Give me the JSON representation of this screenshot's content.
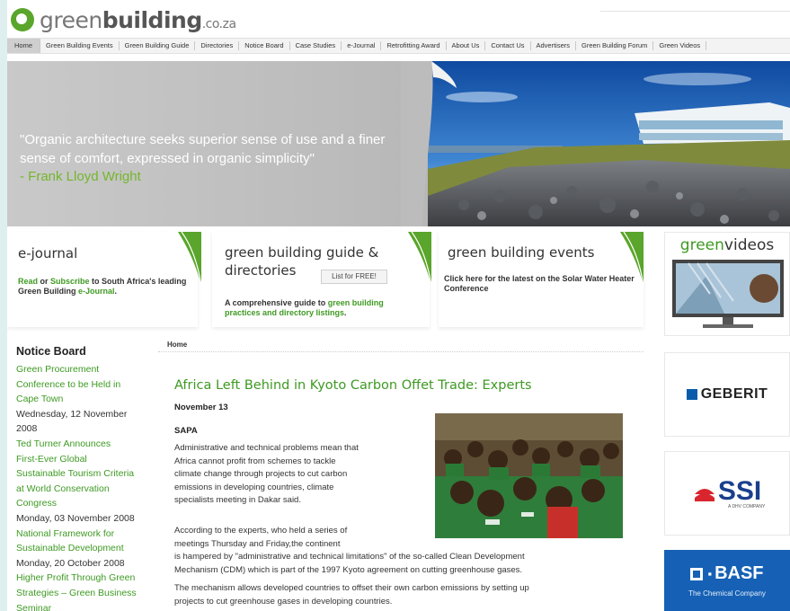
{
  "logo": {
    "part1": "green",
    "part2": "building",
    "suffix": ".co.za"
  },
  "nav": [
    "Home",
    "Green Building Events",
    "Green Building Guide",
    "Directories",
    "Notice Board",
    "Case Studies",
    "e-Journal",
    "Retrofitting Award",
    "About Us",
    "Contact Us",
    "Advertisers",
    "Green Building Forum",
    "Green Videos"
  ],
  "hero": {
    "quote": "\"Organic architecture seeks superior sense of use and a finer sense of comfort, expressed in organic simplicity\"",
    "author": "- Frank Lloyd Wright"
  },
  "boxes": {
    "ejournal": {
      "title": "e-journal",
      "link1": "Read",
      "or": " or ",
      "link2": "Subscribe",
      "text": " to South Africa's leading Green Building ",
      "link3": "e-Journal",
      "end": "."
    },
    "guide": {
      "title_line1": "green building guide &",
      "title_line2": "directories",
      "button": "List for FREE!",
      "text": "A comprehensive guide to ",
      "link": "green building practices and directory listings",
      "end": "."
    },
    "events": {
      "title": "green building events",
      "text": "Click here for the latest on the Solar Water Heater Conference"
    }
  },
  "sidebar_ads": {
    "videos": {
      "title_green": "green",
      "title_rest": "videos"
    },
    "geberit": "GEBERIT",
    "ssi": {
      "name": "SSI",
      "sub": "A DHV COMPANY"
    },
    "basf": {
      "name": "BASF",
      "sub": "The Chemical Company"
    }
  },
  "notice_board": {
    "title": "Notice Board",
    "items": [
      {
        "type": "link",
        "text": "Green Procurement"
      },
      {
        "type": "link",
        "text": "Conference to be Held in"
      },
      {
        "type": "link",
        "text": "Cape Town"
      },
      {
        "type": "date",
        "text": "Wednesday, 12 November"
      },
      {
        "type": "date",
        "text": "2008"
      },
      {
        "type": "link",
        "text": "Ted Turner Announces"
      },
      {
        "type": "link",
        "text": "First-Ever Global"
      },
      {
        "type": "link",
        "text": "Sustainable Tourism Criteria"
      },
      {
        "type": "link",
        "text": "at World Conservation"
      },
      {
        "type": "link",
        "text": "Congress"
      },
      {
        "type": "date",
        "text": "Monday, 03 November 2008"
      },
      {
        "type": "link",
        "text": "National Framework for"
      },
      {
        "type": "link",
        "text": "Sustainable Development"
      },
      {
        "type": "date",
        "text": "Monday, 20 October 2008"
      },
      {
        "type": "link",
        "text": "Higher Profit Through Green"
      },
      {
        "type": "link",
        "text": "Strategies – Green Business"
      },
      {
        "type": "link",
        "text": "Seminar"
      }
    ]
  },
  "article": {
    "breadcrumb": "Home",
    "title": "Africa Left Behind in Kyoto Carbon Offet Trade: Experts",
    "date": "November 13",
    "source": "SAPA",
    "p1": [
      "Administrative and technical problems mean that",
      "Africa cannot profit from schemes to tackle",
      "climate change through projects to cut carbon",
      "emissions in developing countries, climate",
      "specialists meeting in Dakar said."
    ],
    "p2": [
      "According to the experts, who held a series of",
      "meetings Thursday and Friday,the continent"
    ],
    "p2b": [
      "is hampered by \"administrative and technical limitations\" of the so-called Clean Development",
      "Mechanism (CDM) which is part of the 1997 Kyoto agreement on cutting greenhouse gases."
    ],
    "p3": [
      "The mechanism allows developed countries to offset their own carbon emissions by setting up",
      "projects to cut greenhouse gases in developing countries."
    ]
  }
}
